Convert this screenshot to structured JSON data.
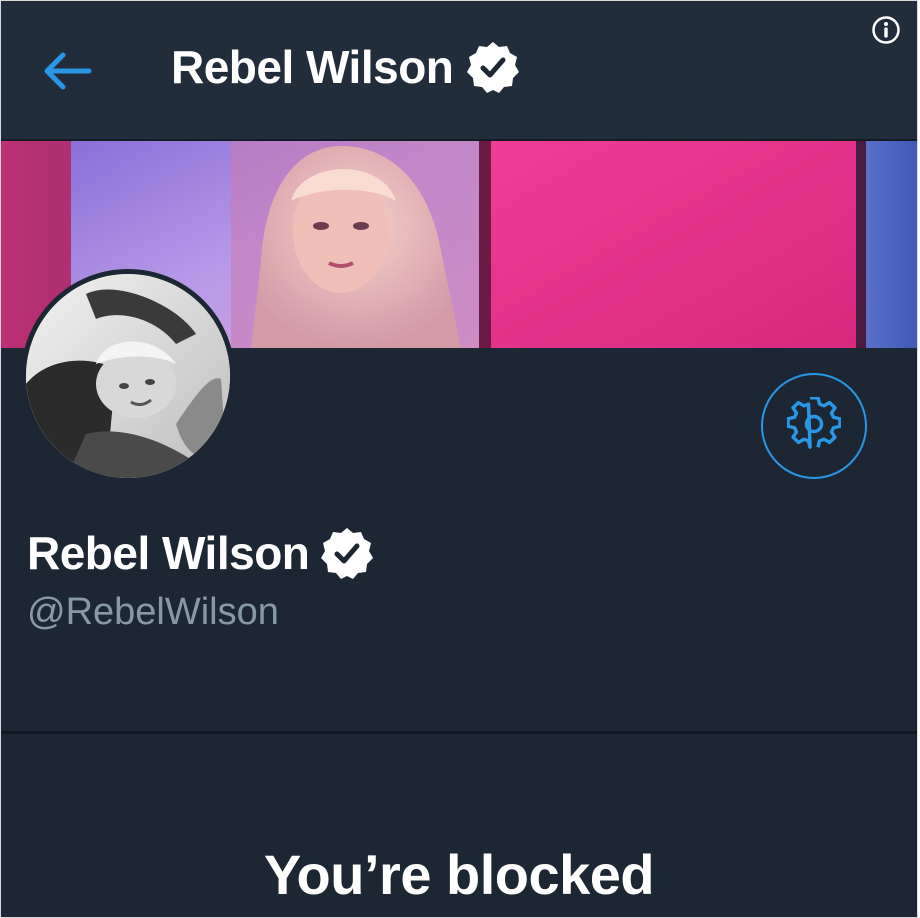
{
  "header": {
    "title": "Rebel Wilson",
    "back_icon": "back-arrow-icon",
    "info_icon": "info-icon"
  },
  "profile": {
    "display_name": "Rebel Wilson",
    "handle": "@RebelWilson",
    "verified": true,
    "settings_icon": "gear-icon"
  },
  "blocked": {
    "message": "You’re blocked"
  },
  "colors": {
    "background": "#1d2733",
    "header_background": "#222d3b",
    "accent": "#2a97e6",
    "text_primary": "#ffffff",
    "text_secondary": "#8899a6",
    "banner_pink": "#e0358f"
  }
}
